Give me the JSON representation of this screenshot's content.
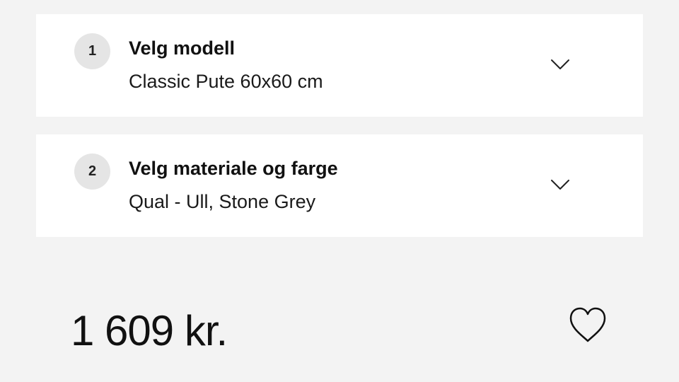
{
  "configurator": {
    "steps": [
      {
        "number": "1",
        "title": "Velg modell",
        "value": "Classic Pute 60x60 cm",
        "icon": "chevron-down-icon"
      },
      {
        "number": "2",
        "title": "Velg materiale og farge",
        "value": "Qual - Ull, Stone Grey",
        "icon": "chevron-down-icon"
      }
    ]
  },
  "pricing": {
    "price": "1 609 kr."
  },
  "favorite": {
    "icon": "heart-icon"
  },
  "colors": {
    "background": "#f3f3f3",
    "card": "#ffffff",
    "step_badge": "#e5e5e5",
    "text": "#111111"
  }
}
